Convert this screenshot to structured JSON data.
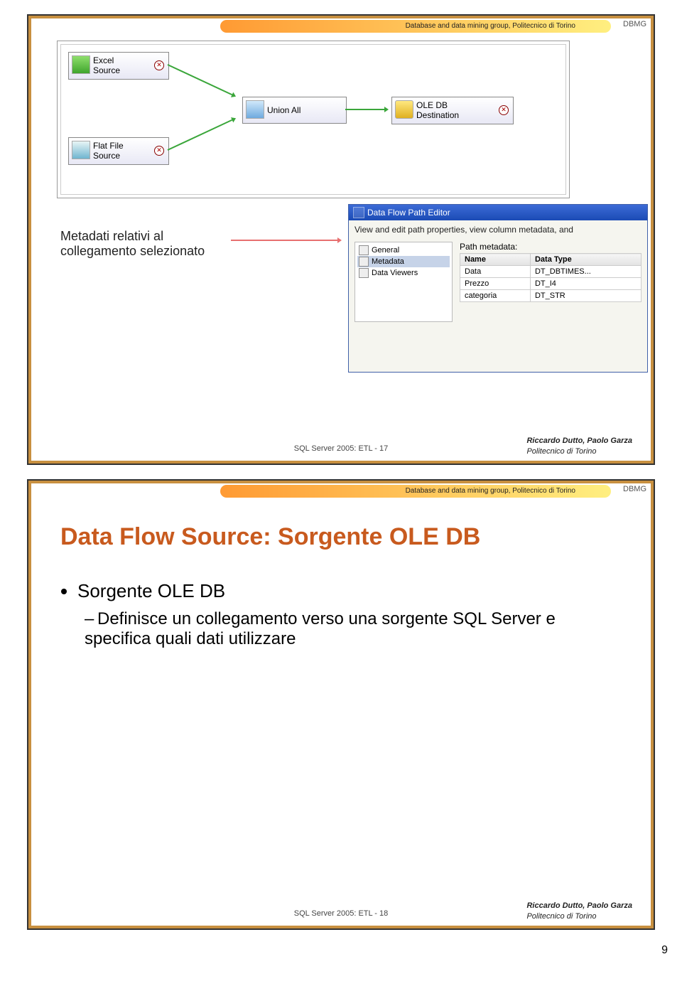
{
  "header": {
    "group_text": "Database and data mining group, Politecnico di Torino",
    "logo": "DBMG"
  },
  "footer": {
    "authors": "Riccardo Dutto, Paolo Garza",
    "inst": "Politecnico di Torino"
  },
  "slide1": {
    "footer_code": "SQL Server 2005: ETL - 17",
    "nodes": {
      "excel": "Excel\nSource",
      "flat": "Flat File\nSource",
      "union": "Union All",
      "dest": "OLE DB\nDestination"
    },
    "annotation": "Metadati relativi al\ncollegamento selezionato",
    "editor": {
      "title": "Data Flow Path Editor",
      "desc": "View and edit path properties, view column metadata, and",
      "tree": [
        "General",
        "Metadata",
        "Data Viewers"
      ],
      "grid_caption": "Path metadata:",
      "columns": [
        "Name",
        "Data Type"
      ],
      "rows": [
        [
          "Data",
          "DT_DBTIMES..."
        ],
        [
          "Prezzo",
          "DT_I4"
        ],
        [
          "categoria",
          "DT_STR"
        ]
      ]
    }
  },
  "slide2": {
    "footer_code": "SQL Server 2005: ETL - 18",
    "title": "Data Flow Source: Sorgente OLE DB",
    "bullet": "Sorgente OLE DB",
    "sub": "Definisce un collegamento verso una sorgente SQL Server e specifica quali dati utilizzare"
  },
  "page_number": "9"
}
